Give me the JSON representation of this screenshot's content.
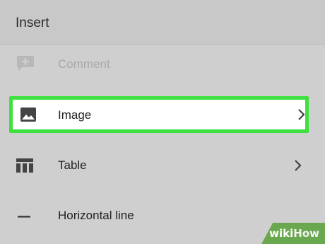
{
  "header": {
    "title": "Insert"
  },
  "menu": {
    "comment": {
      "label": "Comment",
      "icon": "add-comment-icon"
    },
    "image": {
      "label": "Image",
      "icon": "image-icon"
    },
    "table": {
      "label": "Table",
      "icon": "table-icon"
    },
    "horizontal_line": {
      "label": "Horizontal line",
      "icon": "horizontal-line-icon"
    }
  },
  "colors": {
    "highlight": "#3ee03e",
    "background": "#cfcfcf",
    "header": "#c8c8c8",
    "disabled_text": "#a9a9a9"
  },
  "watermark": {
    "wiki": "wiki",
    "how": "How"
  }
}
